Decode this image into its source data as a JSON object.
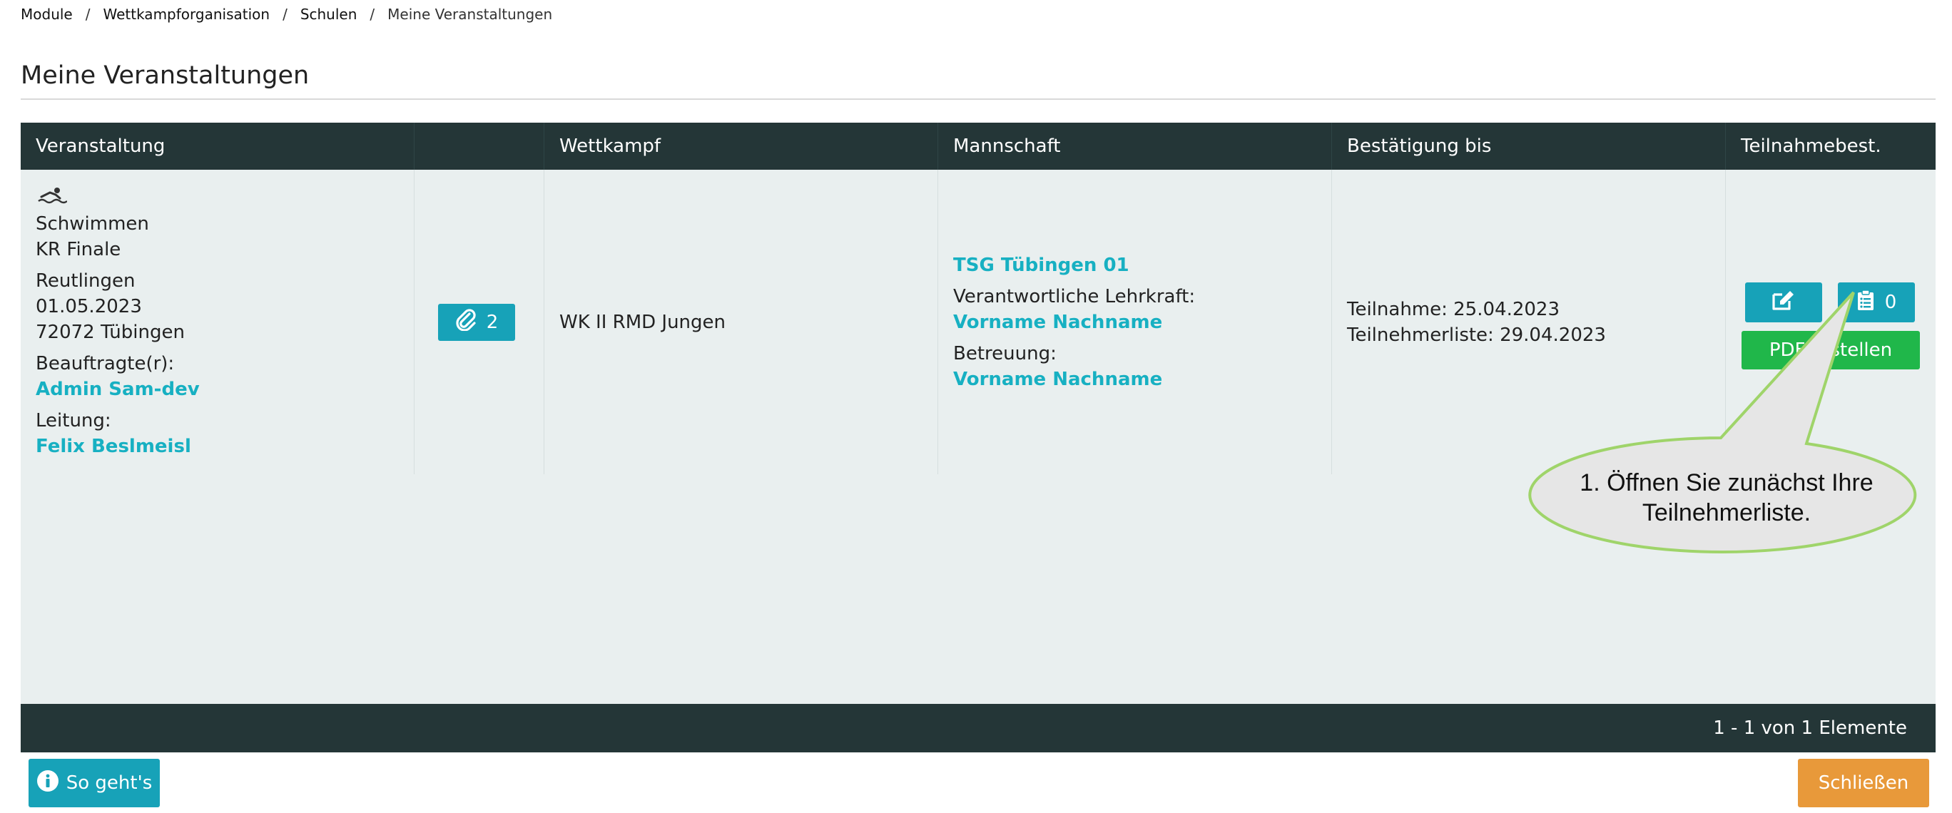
{
  "breadcrumb": {
    "items": [
      "Module",
      "Wettkampforganisation",
      "Schulen",
      "Meine Veranstaltungen"
    ],
    "separator": "/"
  },
  "page": {
    "title": "Meine Veranstaltungen"
  },
  "table": {
    "headers": [
      "Veranstaltung",
      "",
      "Wettkampf",
      "Mannschaft",
      "Bestätigung bis",
      "Teilnahmebest."
    ],
    "row": {
      "sport_icon": "swimmer-icon",
      "sport": "Schwimmen",
      "event": "KR Finale",
      "location": "Reutlingen",
      "date": "01.05.2023",
      "postal_city": "72072 Tübingen",
      "assignee_label": "Beauftragte(r):",
      "assignee": "Admin Sam-dev",
      "lead_label": "Leitung:",
      "lead": "Felix Beslmeisl",
      "attachments_count": "2",
      "competition": "WK II RMD Jungen",
      "team_name": "TSG Tübingen 01",
      "teacher_label": "Verantwortliche Lehrkraft:",
      "teacher": "Vorname Nachname",
      "care_label": "Betreuung:",
      "care": "Vorname Nachname",
      "participation_deadline": "Teilnahme: 25.04.2023",
      "participantlist_deadline": "Teilnehmerliste: 29.04.2023",
      "participants_count": "0",
      "pdf_label": "PDF erstellen"
    },
    "footer": "1 - 1 von 1 Elemente"
  },
  "buttons": {
    "help": "So geht's",
    "close": "Schließen"
  },
  "callout": {
    "line1": "1. Öffnen Sie zunächst Ihre",
    "line2": "Teilnehmerliste."
  },
  "colors": {
    "header_bg": "#243637",
    "body_bg": "#e9efef",
    "accent": "#17a2b8",
    "link": "#17b0c2",
    "pdf": "#20b74a",
    "close": "#e8993a",
    "callout_fill": "#e6e6e6",
    "callout_stroke": "#9fd46a"
  }
}
